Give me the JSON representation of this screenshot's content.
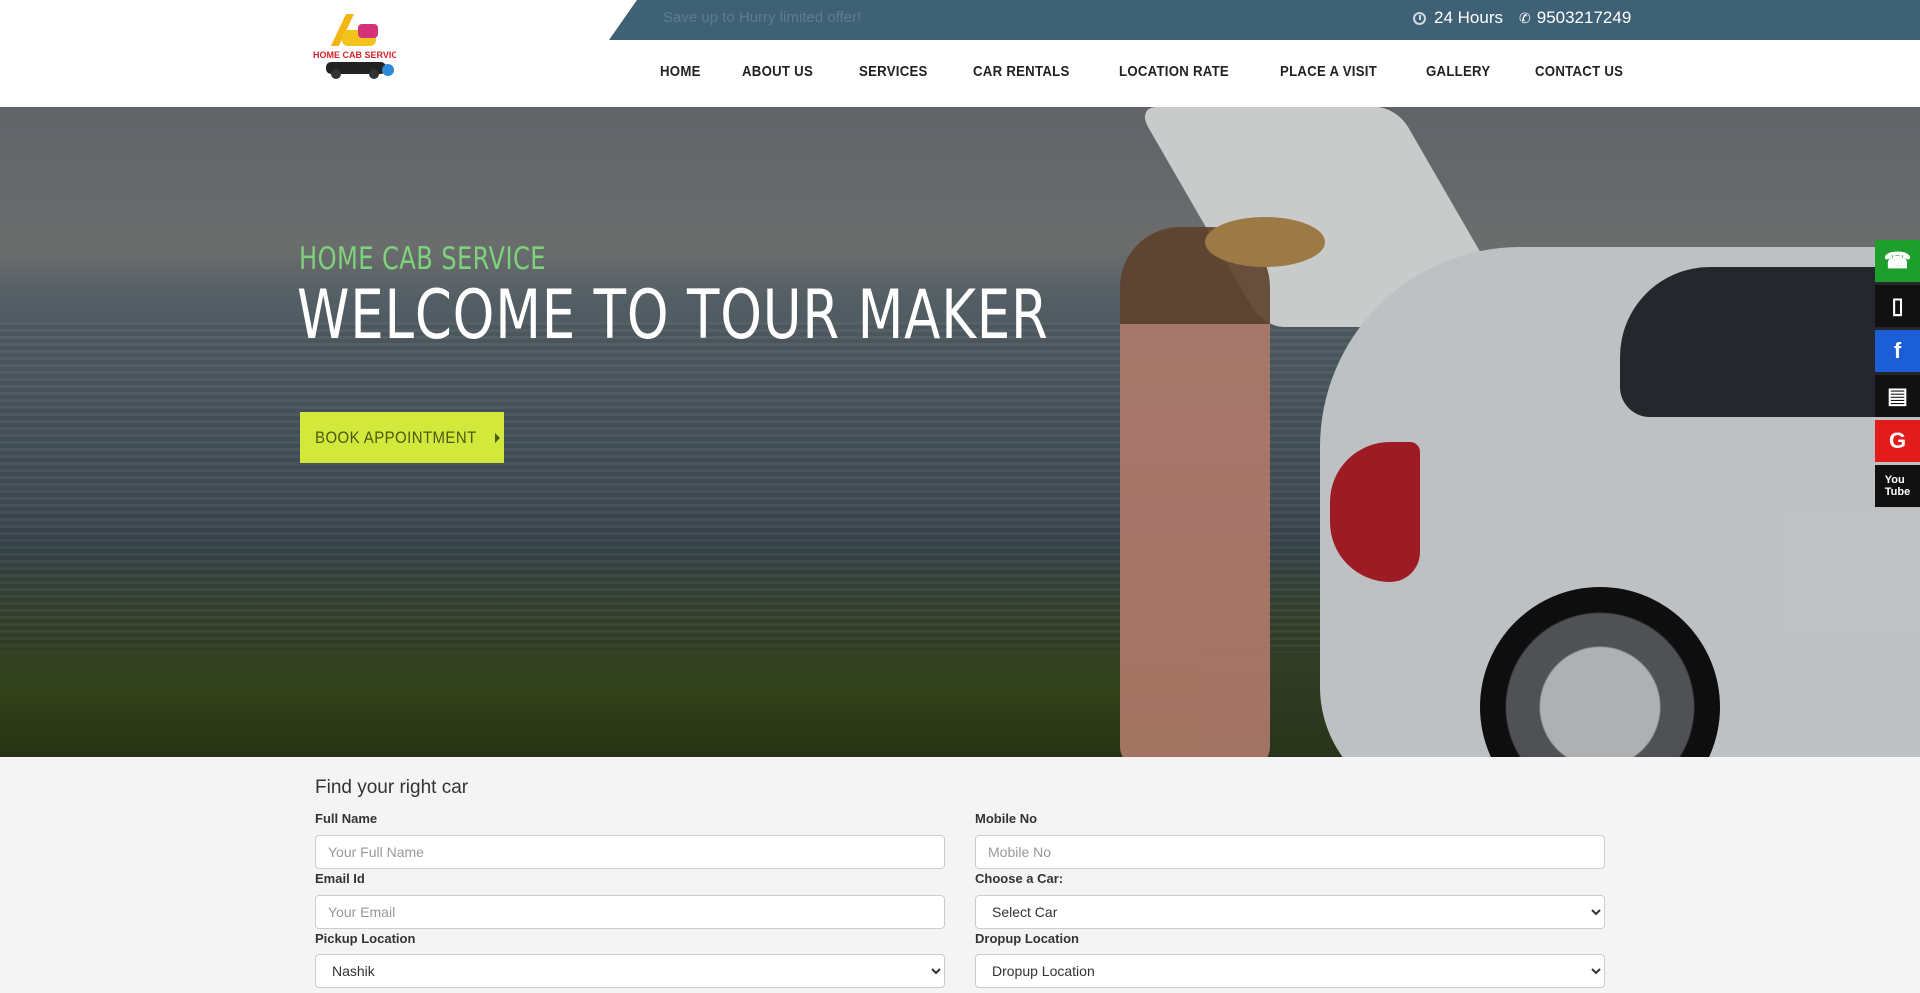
{
  "topbar": {
    "promo": "Save up to Hurry limited offer!",
    "hours": "24 Hours",
    "phone": "9503217249"
  },
  "logo": {
    "text": "HOME CAB SERVICE"
  },
  "nav": [
    "HOME",
    "ABOUT US",
    "SERVICES",
    "CAR RENTALS",
    "LOCATION RATE",
    "PLACE A VISIT",
    "GALLERY",
    "CONTACT US"
  ],
  "hero": {
    "subtitle": "HOME CAB SERVICE",
    "title": "WELCOME TO TOUR MAKER",
    "button": "BOOK APPOINTMENT"
  },
  "social": [
    "whatsapp-icon",
    "mobile-icon",
    "facebook-icon",
    "book-icon",
    "google-icon",
    "youtube-icon"
  ],
  "form": {
    "title": "Find your right car",
    "full_name_label": "Full Name",
    "full_name_placeholder": "Your Full Name",
    "mobile_label": "Mobile No",
    "mobile_placeholder": "Mobile No",
    "email_label": "Email Id",
    "email_placeholder": "Your Email",
    "car_label": "Choose a Car:",
    "car_value": "Select Car",
    "pickup_label": "Pickup Location",
    "pickup_value": "Nashik",
    "dropup_label": "Dropup Location",
    "dropup_value": "Dropup Location"
  },
  "colors": {
    "topstrip": "#3e6176",
    "accent_green": "#7ed27b",
    "button_bg": "#d2e83a"
  }
}
